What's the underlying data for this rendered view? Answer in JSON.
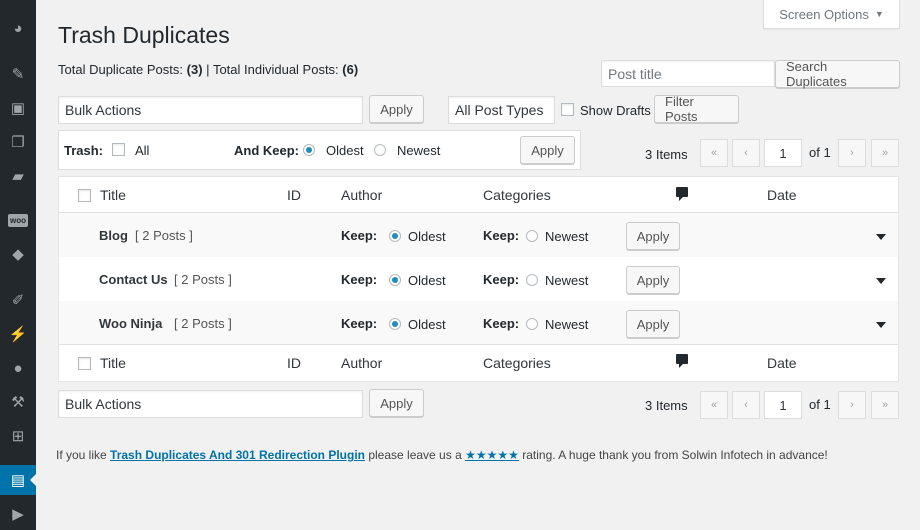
{
  "screen_options": "Screen Options",
  "page_title": "Trash Duplicates",
  "stats": {
    "dup_label": "Total Duplicate Posts:",
    "dup_value": "(3)",
    "sep": "|",
    "ind_label": "Total Individual Posts:",
    "ind_value": "(6)"
  },
  "search": {
    "placeholder": "Post title",
    "button": "Search Duplicates"
  },
  "top_bulk": {
    "value": "Bulk Actions",
    "apply": "Apply"
  },
  "filters": {
    "post_types": "All Post Types",
    "show_drafts": "Show Drafts",
    "filter_button": "Filter Posts"
  },
  "trash_box": {
    "trash_label": "Trash:",
    "all_label": "All",
    "keep_label": "And Keep:",
    "oldest": "Oldest",
    "newest": "Newest",
    "apply": "Apply"
  },
  "pagination": {
    "items": "3 Items",
    "first": "«",
    "prev": "‹",
    "page": "1",
    "of": "of 1",
    "next": "›",
    "last": "»"
  },
  "columns": {
    "title": "Title",
    "id": "ID",
    "author": "Author",
    "categories": "Categories",
    "comments_icon": "comment-bubble-icon",
    "date": "Date"
  },
  "rows": [
    {
      "title": "Blog",
      "count": "[ 2 Posts ]",
      "keep": "Keep:",
      "oldest": "Oldest",
      "newest": "Newest",
      "apply": "Apply"
    },
    {
      "title": "Contact Us",
      "count": "[ 2 Posts ]",
      "keep": "Keep:",
      "oldest": "Oldest",
      "newest": "Newest",
      "apply": "Apply"
    },
    {
      "title": "Woo Ninja",
      "count": "[ 2 Posts ]",
      "keep": "Keep:",
      "oldest": "Oldest",
      "newest": "Newest",
      "apply": "Apply"
    }
  ],
  "bottom_bulk": {
    "value": "Bulk Actions",
    "apply": "Apply"
  },
  "footer": {
    "prefix": "If you like",
    "plugin_link": "Trash Duplicates And 301 Redirection Plugin",
    "middle": "please leave us a",
    "stars": "★★★★★",
    "suffix": "rating. A huge thank you from Solwin Infotech in advance!"
  },
  "sidebar_icons": [
    "dashboard-icon",
    "pin-icon",
    "media-icon",
    "pages-icon",
    "comments-icon",
    "woo-icon",
    "box-icon",
    "brush-icon",
    "plugin-icon",
    "users-icon",
    "wrench-icon",
    "settings-icon",
    "document-icon",
    "play-icon"
  ],
  "colors": {
    "accent": "#0073aa",
    "sidebar": "#23282d",
    "radio_checked": "#1e8cbe"
  }
}
